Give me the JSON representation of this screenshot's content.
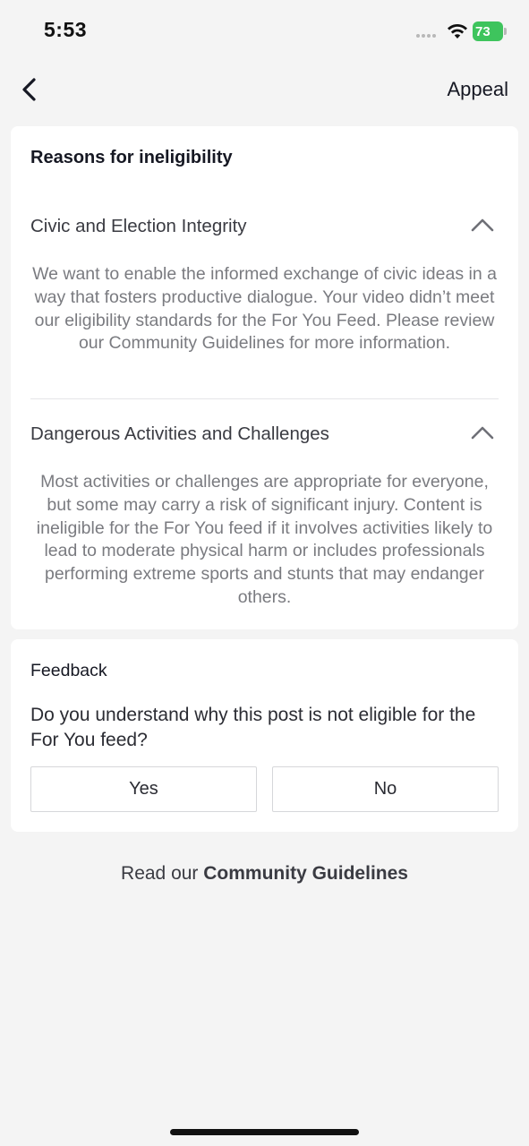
{
  "status_bar": {
    "time": "5:53",
    "battery_level": "73",
    "battery_color": "#3ec45d",
    "icons": [
      "signal-dots-icon",
      "wifi-icon",
      "battery-charging-icon"
    ]
  },
  "nav": {
    "back_icon": "chevron-left-icon",
    "appeal_label": "Appeal"
  },
  "reasons": {
    "title": "Reasons for ineligibility",
    "items": [
      {
        "label": "Civic and Election Integrity",
        "expanded": true,
        "icon": "chevron-up-icon",
        "description": "We want to enable the informed exchange of civic ideas in a way that fosters productive dialogue. Your video didn’t meet our eligibility standards for the For You Feed. Please review our Community Guidelines for more information."
      },
      {
        "label": "Dangerous Activities and Challenges",
        "expanded": true,
        "icon": "chevron-up-icon",
        "description": "Most activities or challenges are appropriate for everyone, but some may carry a risk of significant injury. Content is ineligible for the For You feed if it involves activities likely to lead to moderate physical harm or includes professionals performing extreme sports and stunts that may endanger others."
      }
    ]
  },
  "feedback": {
    "title": "Feedback",
    "question": "Do you understand why this post is not eligible for the For You feed?",
    "yes_label": "Yes",
    "no_label": "No"
  },
  "footer": {
    "prefix": "Read our ",
    "link_label": "Community Guidelines"
  }
}
